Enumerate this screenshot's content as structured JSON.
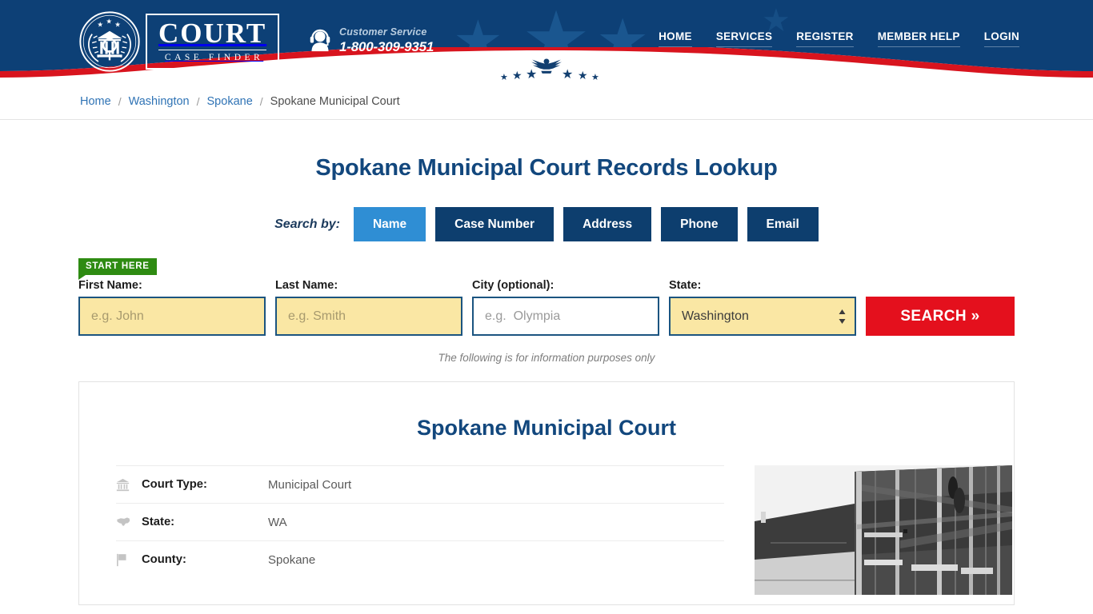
{
  "header": {
    "logo": {
      "main": "COURT",
      "sub": "CASE FINDER",
      "seal_icon": "courthouse-seal-icon"
    },
    "support": {
      "icon": "headset-agent-icon",
      "label": "Customer Service",
      "phone": "1-800-309-9351"
    },
    "nav": [
      {
        "label": "HOME"
      },
      {
        "label": "SERVICES"
      },
      {
        "label": "REGISTER"
      },
      {
        "label": "MEMBER HELP"
      },
      {
        "label": "LOGIN"
      }
    ],
    "colors": {
      "navy": "#0d4076",
      "red": "#d8141e",
      "star": "#1a568f"
    }
  },
  "breadcrumb": {
    "separator": "/",
    "items": [
      {
        "label": "Home",
        "link": true
      },
      {
        "label": "Washington",
        "link": true
      },
      {
        "label": "Spokane",
        "link": true
      },
      {
        "label": "Spokane Municipal Court",
        "link": false
      }
    ]
  },
  "main": {
    "page_title": "Spokane Municipal Court Records Lookup",
    "search_by_label": "Search by:",
    "tabs": [
      {
        "label": "Name",
        "active": true
      },
      {
        "label": "Case Number",
        "active": false
      },
      {
        "label": "Address",
        "active": false
      },
      {
        "label": "Phone",
        "active": false
      },
      {
        "label": "Email",
        "active": false
      }
    ],
    "start_here_badge": "START HERE",
    "form": {
      "first_name": {
        "label": "First Name:",
        "placeholder": "e.g. John",
        "value": ""
      },
      "last_name": {
        "label": "Last Name:",
        "placeholder": "e.g. Smith",
        "value": ""
      },
      "city": {
        "label": "City (optional):",
        "placeholder": "e.g.  Olympia",
        "value": ""
      },
      "state": {
        "label": "State:",
        "value": "Washington"
      },
      "search_button": "SEARCH »"
    },
    "disclaimer": "The following is for information purposes only"
  },
  "card": {
    "title": "Spokane Municipal Court",
    "details": [
      {
        "icon": "bank-building-icon",
        "key": "Court Type:",
        "value": "Municipal Court"
      },
      {
        "icon": "us-map-icon",
        "key": "State:",
        "value": "WA"
      },
      {
        "icon": "flag-icon",
        "key": "County:",
        "value": "Spokane"
      }
    ],
    "photo_alt": "courthouse-building-photo"
  },
  "colors": {
    "accent_blue": "#2f8ed4",
    "deep_blue": "#0d3e6e",
    "title_blue": "#12477d",
    "search_red": "#e4101d",
    "badge_green": "#2e8b12",
    "field_yellow": "#fae7a4"
  }
}
